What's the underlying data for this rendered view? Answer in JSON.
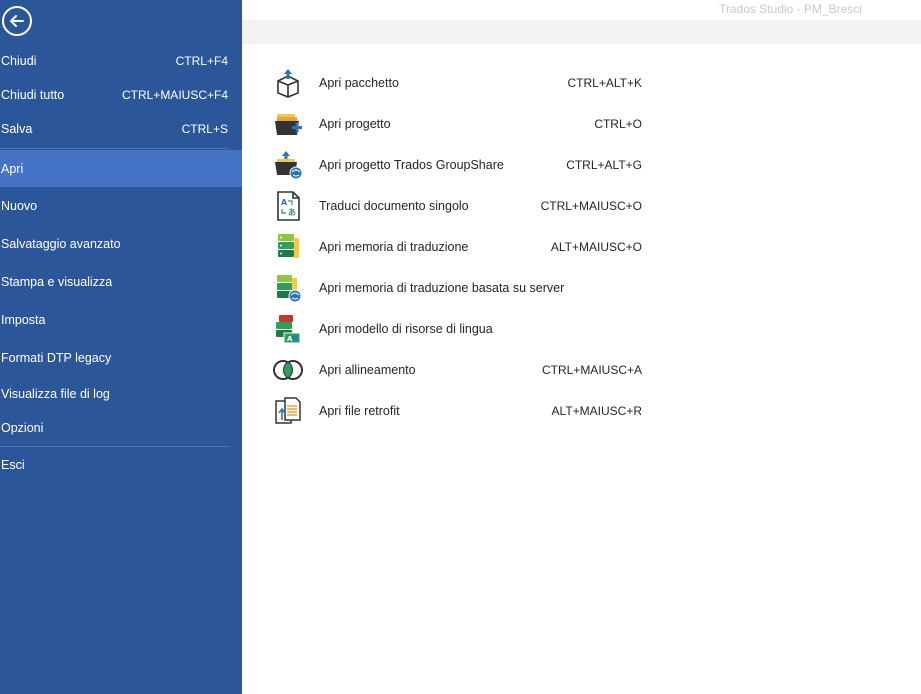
{
  "window": {
    "title": "Trados Studio - PM_Bresci"
  },
  "sidebar": {
    "items": [
      {
        "label": "Chiudi",
        "shortcut": "CTRL+F4"
      },
      {
        "label": "Chiudi tutto",
        "shortcut": "CTRL+MAIUSC+F4"
      },
      {
        "label": "Salva",
        "shortcut": "CTRL+S"
      },
      {
        "label": "Apri",
        "shortcut": ""
      },
      {
        "label": "Nuovo",
        "shortcut": ""
      },
      {
        "label": "Salvataggio avanzato",
        "shortcut": ""
      },
      {
        "label": "Stampa e visualizza",
        "shortcut": ""
      },
      {
        "label": "Imposta",
        "shortcut": ""
      },
      {
        "label": "Formati DTP legacy",
        "shortcut": ""
      },
      {
        "label": "Visualizza file di log",
        "shortcut": ""
      },
      {
        "label": "Opzioni",
        "shortcut": ""
      },
      {
        "label": "Esci",
        "shortcut": ""
      }
    ],
    "active": "Apri"
  },
  "open_panel": {
    "items": [
      {
        "label": "Apri pacchetto",
        "shortcut": "CTRL+ALT+K",
        "icon": "package-icon"
      },
      {
        "label": "Apri progetto",
        "shortcut": "CTRL+O",
        "icon": "project-folder-icon"
      },
      {
        "label": "Apri progetto Trados GroupShare",
        "shortcut": "CTRL+ALT+G",
        "icon": "groupshare-project-icon"
      },
      {
        "label": "Traduci documento singolo",
        "shortcut": "CTRL+MAIUSC+O",
        "icon": "translate-document-icon"
      },
      {
        "label": "Apri memoria di traduzione",
        "shortcut": "ALT+MAIUSC+O",
        "icon": "translation-memory-icon"
      },
      {
        "label": "Apri memoria di traduzione basata su server",
        "shortcut": "",
        "icon": "server-translation-memory-icon"
      },
      {
        "label": "Apri modello di risorse di lingua",
        "shortcut": "",
        "icon": "language-resource-template-icon"
      },
      {
        "label": "Apri allineamento",
        "shortcut": "CTRL+MAIUSC+A",
        "icon": "alignment-icon"
      },
      {
        "label": "Apri file retrofit",
        "shortcut": "ALT+MAIUSC+R",
        "icon": "retrofit-file-icon"
      }
    ]
  },
  "colors": {
    "sidebar_bg": "#2b579a",
    "sidebar_active": "#4472c4",
    "title_text": "#c8c8c8"
  }
}
